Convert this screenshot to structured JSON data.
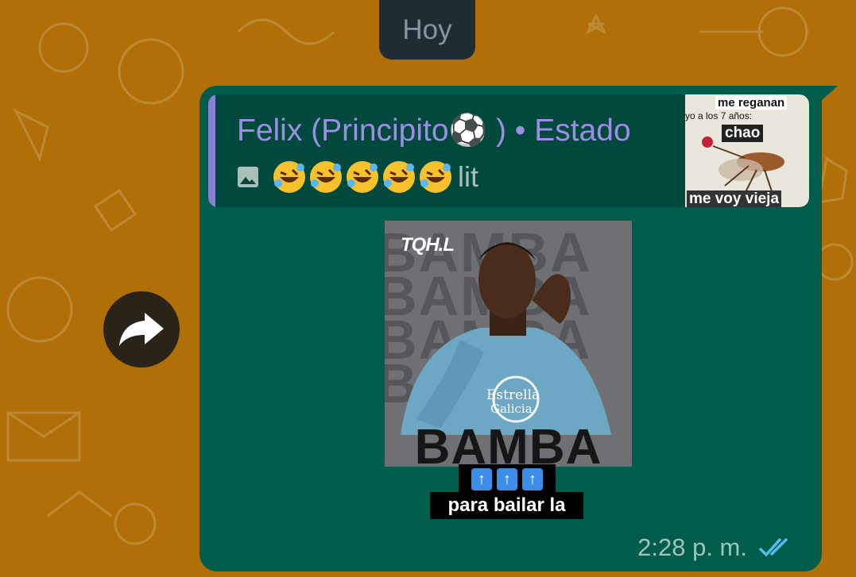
{
  "date_label": "Hoy",
  "message": {
    "quote": {
      "author": "Felix (Principito⚽ ) • Estado",
      "text": "lit",
      "emojis": [
        "laugh",
        "laugh",
        "laugh",
        "laugh",
        "laugh"
      ],
      "thumbnail": {
        "line1": "me reganan",
        "line2": "yo a los 7 años:",
        "line3": "chao",
        "line4": "me voy vieja"
      }
    },
    "image": {
      "logo": "TQH.L",
      "headline": "BAMBA",
      "background_word": "BAMBA",
      "sponsor_line1": "Estrella",
      "sponsor_line2": "Galicia"
    },
    "sticker_arrows": "⬆⬆⬆",
    "caption": "para bailar la",
    "time": "2:28 p. m.",
    "status": "read"
  },
  "colors": {
    "wallpaper": "#b06f07",
    "bubble": "#005c4b",
    "quote_bg": "#02493d",
    "quote_bar": "#8a7fd6",
    "author": "#9a8fe2",
    "read_ticks": "#53bdeb"
  }
}
